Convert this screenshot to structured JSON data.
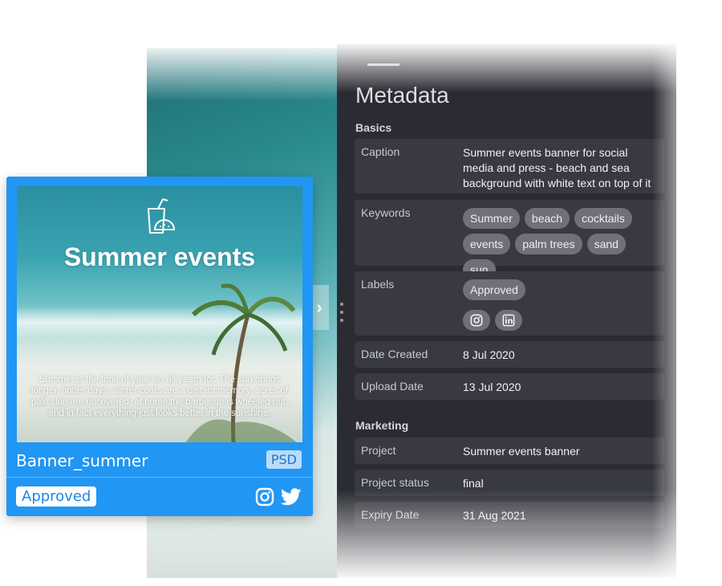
{
  "metadata": {
    "title": "Metadata",
    "basics_label": "Basics",
    "caption": {
      "key": "Caption",
      "value": "Summer events banner for social media and press - beach and sea background with white text on top of it"
    },
    "keywords": {
      "key": "Keywords",
      "items": [
        "Summer",
        "beach",
        "cocktails",
        "events",
        "palm trees",
        "sand",
        "sun"
      ]
    },
    "labels": {
      "key": "Labels",
      "approved": "Approved",
      "icons": [
        "instagram-icon",
        "linkedin-icon"
      ]
    },
    "date_created": {
      "key": "Date Created",
      "value": "8 Jul 2020"
    },
    "upload_date": {
      "key": "Upload Date",
      "value": "13 Jul 2020"
    },
    "marketing_label": "Marketing",
    "project": {
      "key": "Project",
      "value": "Summer events banner"
    },
    "project_status": {
      "key": "Project status",
      "value": "final"
    },
    "expiry_date": {
      "key": "Expiry Date",
      "value": "31 Aug 2021"
    }
  },
  "card": {
    "headline": "Summer events",
    "body_text": "Summer is the time of year we all yearn for. The sun brings longer, hotter days, winter coats are a distant memory, acres of pale skin are uncovered, at home the barbecue is wheeled out, and in fact everything just looks better in the sunshine.",
    "name": "Banner_summer",
    "format": "PSD",
    "status": "Approved",
    "social_icons": [
      "instagram-icon",
      "twitter-icon"
    ],
    "accent_color": "#2196f3"
  },
  "colors": {
    "panel_bg": "#2b2c33",
    "row_bg": "#383941",
    "chip_bg": "#6f7078"
  }
}
